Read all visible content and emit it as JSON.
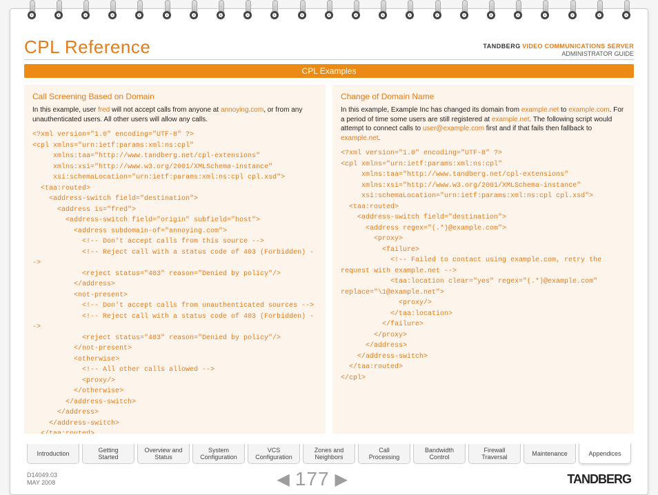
{
  "header": {
    "title": "CPL Reference",
    "brand": "TANDBERG",
    "product": "VIDEO COMMUNICATIONS SERVER",
    "subtitle": "ADMINISTRATOR GUIDE"
  },
  "section_bar": "CPL Examples",
  "left": {
    "heading": "Call Screening Based on Domain",
    "intro_a": "In this example, user ",
    "intro_hl1": "fred",
    "intro_b": " will not accept calls from anyone at ",
    "intro_hl2": "annoying.com",
    "intro_c": ", or from any unauthenticated users. All other users will allow any calls.",
    "code": "<?xml version=\"1.0\" encoding=\"UTF-8\" ?>\n<cpl xmlns=\"urn:ietf:params:xml:ns:cpl\"\n     xmlns:taa=\"http://www.tandberg.net/cpl-extensions\"\n     xmlns:xsi=\"http://www.w3.org/2001/XMLSchema-instance\"\n     xsi:schemaLocation=\"urn:ietf:params:xml:ns:cpl cpl.xsd\">\n  <taa:routed>\n    <address-switch field=\"destination\">\n      <address is=\"fred\">\n        <address-switch field=\"origin\" subfield=\"host\">\n          <address subdomain-of=\"annoying.com\">\n            <!-- Don't accept calls from this source -->\n            <!-- Reject call with a status code of 403 (Forbidden) -->\n            <reject status=\"403\" reason=\"Denied by policy\"/>\n          </address>\n          <not-present>\n            <!-- Don't accept calls from unauthenticated sources -->\n            <!-- Reject call with a status code of 403 (Forbidden) -->\n            <reject status=\"403\" reason=\"Denied by policy\"/>\n          </not-present>\n          <otherwise>\n            <!-- All other calls allowed -->\n            <proxy/>\n          </otherwise>\n        </address-switch>\n      </address>\n    </address-switch>\n  </taa:routed>\n</cpl>"
  },
  "right": {
    "heading": "Change of Domain Name",
    "intro_a": "In this example, Example Inc has changed its domain from ",
    "intro_hl1": "example.net",
    "intro_b": " to ",
    "intro_hl2": "example.com",
    "intro_c": ". For a period of time some users are still registered at ",
    "intro_hl3": "example.net",
    "intro_d": ". The following script would attempt to connect calls to ",
    "intro_hl4": "user@example.com",
    "intro_e": " first and if that fails then fallback to ",
    "intro_hl5": "example.net",
    "intro_f": ".",
    "code": "<?xml version=\"1.0\" encoding=\"UTF-8\" ?>\n<cpl xmlns=\"urn:ietf:params:xml:ns:cpl\"\n     xmlns:taa=\"http://www.tandberg.net/cpl-extensions\"\n     xmlns:xsi=\"http://www.w3.org/2001/XMLSchema-instance\"\n     xsi:schemaLocation=\"urn:ietf:params:xml:ns:cpl cpl.xsd\">\n  <taa:routed>\n    <address-switch field=\"destination\">\n      <address regex=\"(.*)@example.com\">\n        <proxy>\n          <failure>\n            <!-- Failed to contact using example.com, retry the request with example.net -->\n            <taa:location clear=\"yes\" regex=\"(.*)@example.com\" replace=\"\\1@example.net\">\n              <proxy/>\n            </taa:location>\n          </failure>\n        </proxy>\n      </address>\n    </address-switch>\n  </taa:routed>\n</cpl>"
  },
  "tabs": [
    "Introduction",
    "Getting Started",
    "Overview and Status",
    "System Configuration",
    "VCS Configuration",
    "Zones and Neighbors",
    "Call Processing",
    "Bandwidth Control",
    "Firewall Traversal",
    "Maintenance",
    "Appendices"
  ],
  "active_tab_index": 10,
  "footer": {
    "doc_id": "D14049.03",
    "date": "MAY 2008",
    "page": "177",
    "logo": "TANDBERG"
  }
}
